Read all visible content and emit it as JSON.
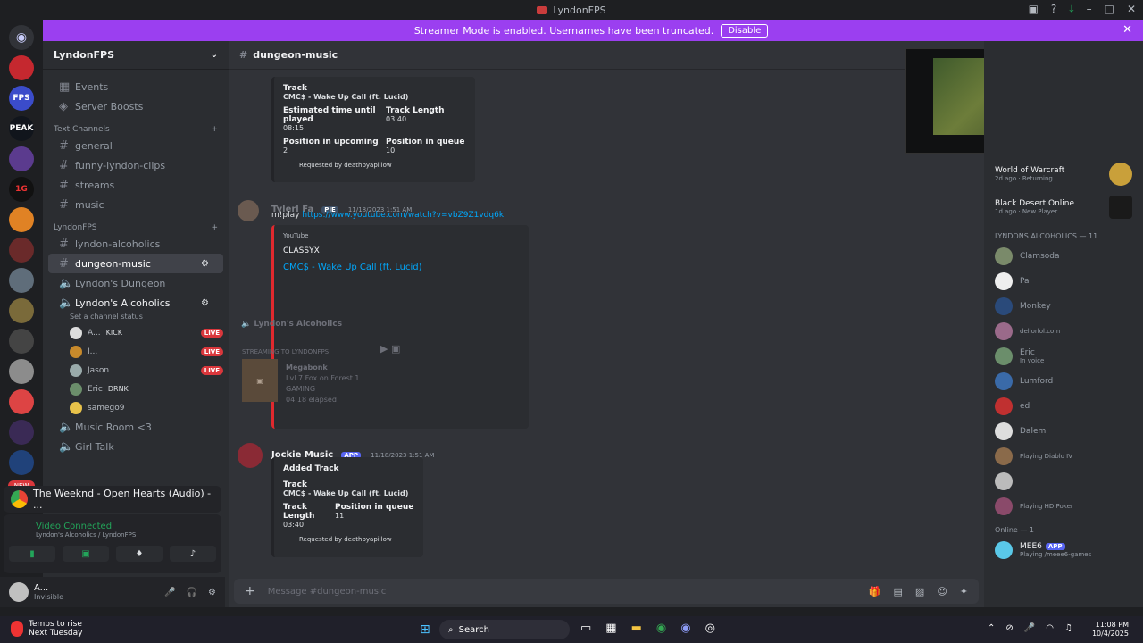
{
  "window": {
    "title": "LyndonFPS"
  },
  "banner": {
    "text": "Streamer Mode is enabled. Usernames have been truncated.",
    "button": "Disable"
  },
  "servers": [
    "DM",
    "FPS",
    "PEAK",
    "1G",
    "NEW"
  ],
  "guild": {
    "name": "LyndonFPS"
  },
  "top_items": [
    {
      "label": "Events"
    },
    {
      "label": "Server Boosts"
    }
  ],
  "text_category": "Text Channels",
  "text_channels": [
    "general",
    "funny-lyndon-clips",
    "streams",
    "music"
  ],
  "lyndon_category": "LyndonFPS",
  "lyndon_channels": [
    "lyndon-alcoholics",
    "dungeon-music"
  ],
  "voice_channels": [
    "Lyndon's Dungeon",
    "Lyndon's Alcoholics"
  ],
  "status_hint": "Set a channel status",
  "voice_users": [
    {
      "name": "A...",
      "tag": "KICK",
      "live": "LIVE"
    },
    {
      "name": "I...",
      "tag": "",
      "live": "LIVE"
    },
    {
      "name": "Jason",
      "tag": "",
      "live": "LIVE"
    },
    {
      "name": "Eric",
      "tag": "DRNK",
      "live": ""
    },
    {
      "name": "samego9",
      "tag": "",
      "live": ""
    }
  ],
  "more_voice": [
    "Music Room <3",
    "Girl Talk"
  ],
  "activity": {
    "title": "The Weeknd - Open Hearts (Audio) - ..."
  },
  "voice_panel": {
    "status": "Video Connected",
    "channel": "Lyndon's Alcoholics / LyndonFPS"
  },
  "user": {
    "name": "A...",
    "status": "Invisible"
  },
  "channel_header": "dungeon-music",
  "top_embed": {
    "track_label": "Track",
    "track": "CMC$ - Wake Up Call (ft. Lucid)",
    "eta_label": "Estimated time until played",
    "eta": "08:15",
    "len_label": "Track Length",
    "len": "03:40",
    "pos_up_label": "Position in upcoming",
    "pos_up": "2",
    "pos_q_label": "Position in queue",
    "pos_q": "10",
    "requested": "Requested by deathbyapillow"
  },
  "msg1": {
    "author": "Tylerl Fa",
    "badge": "PIE",
    "time": "11/18/2023 1:51 AM",
    "command": "m!play",
    "url": "https://www.youtube.com/watch?v=vbZ9Z1vdq6k"
  },
  "yt_embed": {
    "provider": "YouTube",
    "channel": "CLASSYX",
    "title": "CMC$ - Wake Up Call (ft. Lucid)"
  },
  "overlay": {
    "channel": "Lyndon's Alcoholics",
    "streaming": "STREAMING TO LYNDONFPS",
    "game": "Megabonk",
    "line1": "Lvl 7 Fox on Forest 1",
    "line2": "GAMING",
    "line3": "04:18 elapsed"
  },
  "msg2": {
    "author": "Jockie Music",
    "badge": "APP",
    "time": "11/18/2023 1:51 AM"
  },
  "added_embed": {
    "header": "Added Track",
    "track_label": "Track",
    "track": "CMC$ - Wake Up Call (ft. Lucid)",
    "len_label": "Track Length",
    "len": "03:40",
    "pos_label": "Position in queue",
    "pos": "11",
    "requested": "Requested by deathbyapillow"
  },
  "composer": {
    "placeholder": "Message #dungeon-music"
  },
  "games": [
    {
      "name": "World of Warcraft",
      "sub": "2d ago · Returning"
    },
    {
      "name": "Black Desert Online",
      "sub": "1d ago · New Player"
    }
  ],
  "members_header": "LYNDONS ALCOHOLICS — 11",
  "members": [
    {
      "name": "Clamsoda",
      "sub": ""
    },
    {
      "name": "Pa",
      "sub": ""
    },
    {
      "name": "Monkey",
      "sub": ""
    },
    {
      "name": "",
      "sub": "dellorlol.com"
    },
    {
      "name": "Eric",
      "sub": "In voice"
    },
    {
      "name": "Lumford",
      "sub": ""
    },
    {
      "name": "ed",
      "sub": ""
    },
    {
      "name": "Dalem",
      "sub": ""
    },
    {
      "name": "",
      "sub": "Playing Diablo IV"
    },
    {
      "name": "",
      "sub": ""
    },
    {
      "name": "",
      "sub": "Playing HD Poker"
    }
  ],
  "online_header": "Online — 1",
  "mee6": {
    "name": "MEE6",
    "badge": "APP",
    "sub": "Playing /meee6-games"
  },
  "taskbar": {
    "weather1": "Temps to rise",
    "weather2": "Next Tuesday",
    "search": "Search",
    "time": "11:08 PM",
    "date": "10/4/2025"
  }
}
